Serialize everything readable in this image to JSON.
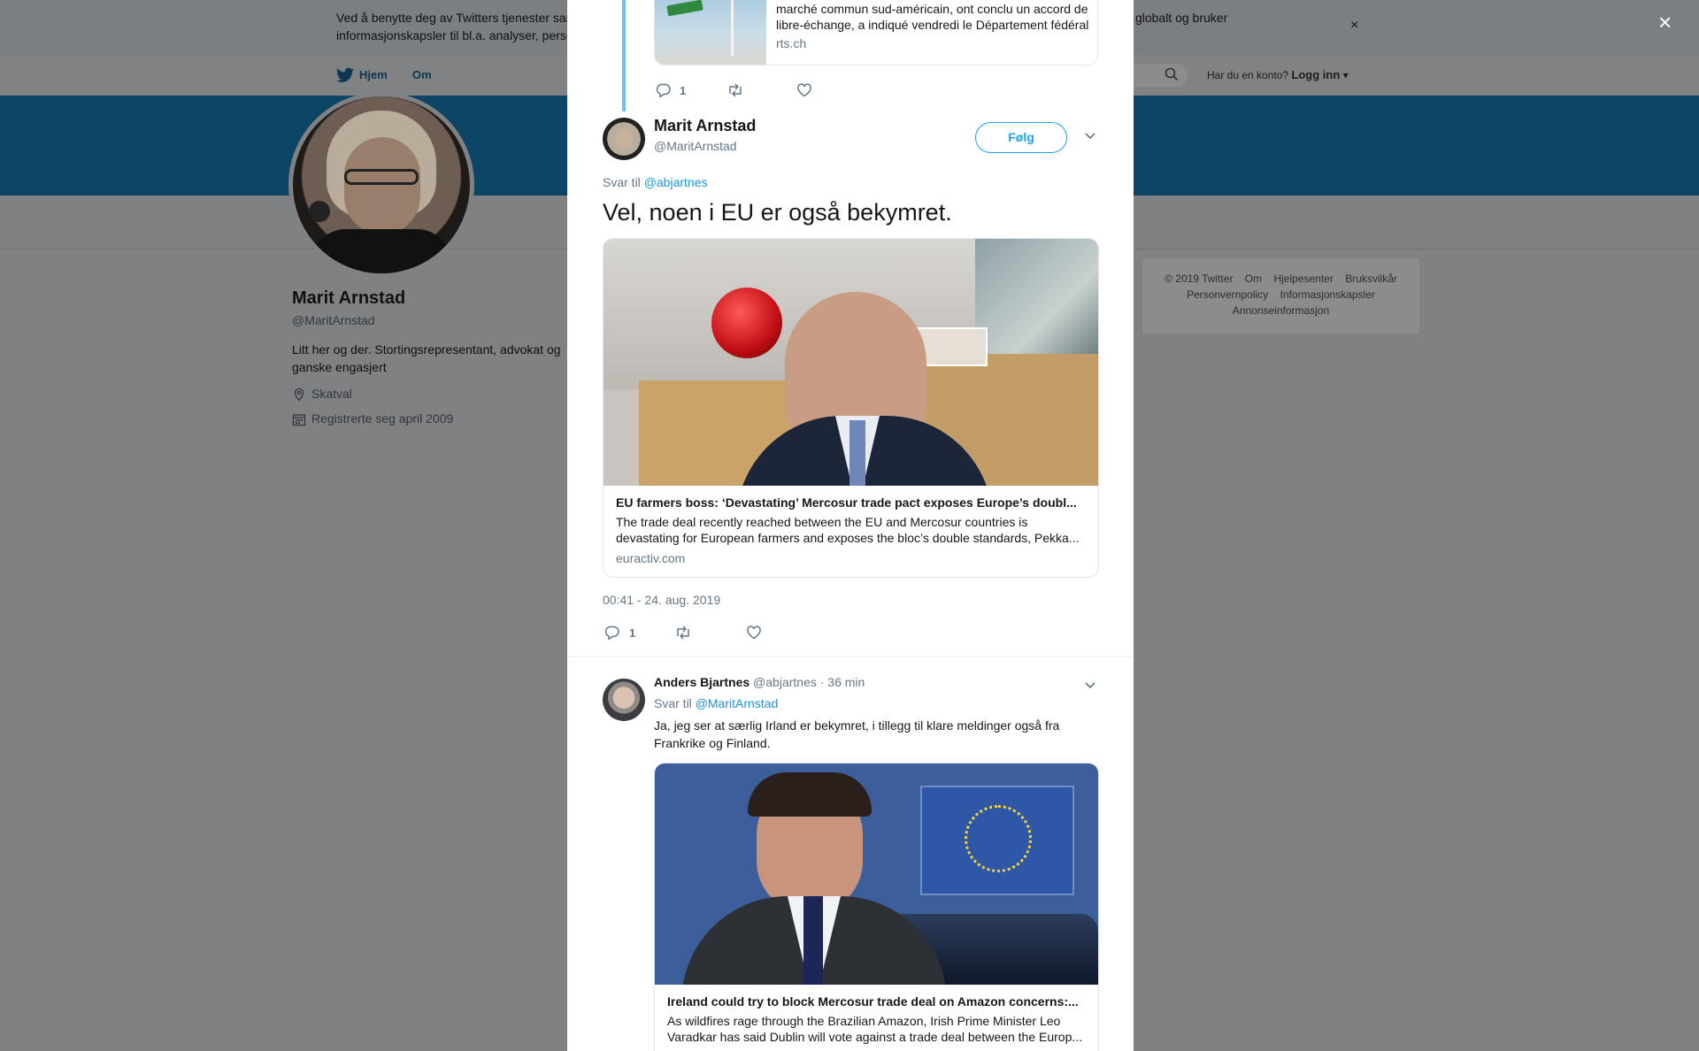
{
  "cookie_bar": {
    "text": "Ved å benytte deg av Twitters tjenester samtykker du til vår bruk av informasjonskapsler og dataoverføring utenfor EU. Vi og våre partnere operer globalt og bruker informasjonskapsler til bl.a. analyser, personalisering og annonser.",
    "close_glyph": "×"
  },
  "nav": {
    "home": "Hjem",
    "about": "Om",
    "login_prompt": "Har du en konto?",
    "login": "Logg inn"
  },
  "profile": {
    "name": "Marit Arnstad",
    "handle": "@MaritArnstad",
    "bio": "Litt her og der. Stortingsrepresentant, advokat og ganske engasjert",
    "location": "Skatval",
    "joined": "Registrerte seg april 2009"
  },
  "footer": {
    "links_row1": [
      "© 2019 Twitter",
      "Om",
      "Hjelpesenter",
      "Bruksvilkår"
    ],
    "links_row2": [
      "Personvernpolicy",
      "Informasjonskapsler"
    ],
    "links_row3": [
      "Annonseinformasjon"
    ]
  },
  "modal_close": "×",
  "prev_tweet": {
    "card_desc": "marché commun sud-américain, ont conclu un accord de libre-échange, a indiqué vendredi le Département fédéral",
    "card_domain": "rts.ch",
    "reply_count": "1"
  },
  "main_tweet": {
    "name": "Marit Arnstad",
    "handle": "@MaritArnstad",
    "follow": "Følg",
    "reply_prefix": "Svar til",
    "reply_to": "@abjartnes",
    "text": "Vel, noen i EU er også bekymret.",
    "card_title": "EU farmers boss: ‘Devastating’ Mercosur trade pact exposes Europe’s doubl...",
    "card_desc": "The trade deal recently reached between the EU and Mercosur countries is devastating for European farmers and exposes the bloc’s double standards, Pekka...",
    "card_domain": "euractiv.com",
    "timestamp": "00:41 - 24. aug. 2019",
    "reply_count": "1"
  },
  "reply_tweet": {
    "name": "Anders Bjartnes",
    "handle": "@abjartnes",
    "time": "· 36 min",
    "reply_prefix": "Svar til",
    "reply_to": "@MaritArnstad",
    "text": "Ja, jeg ser at særlig Irland er bekymret, i tillegg til klare meldinger også fra Frankrike og Finland.",
    "card_title": "Ireland could try to block Mercosur trade deal on Amazon concerns:...",
    "card_desc": "As wildfires rage through the Brazilian Amazon, Irish Prime Minister Leo Varadkar has said Dublin will vote against a trade deal between the Europ..."
  },
  "colors": {
    "twitter_blue": "#1da1f2",
    "link_blue": "#1b95e0",
    "overlay_banner": "#0d4566",
    "muted_text": "#657786"
  }
}
